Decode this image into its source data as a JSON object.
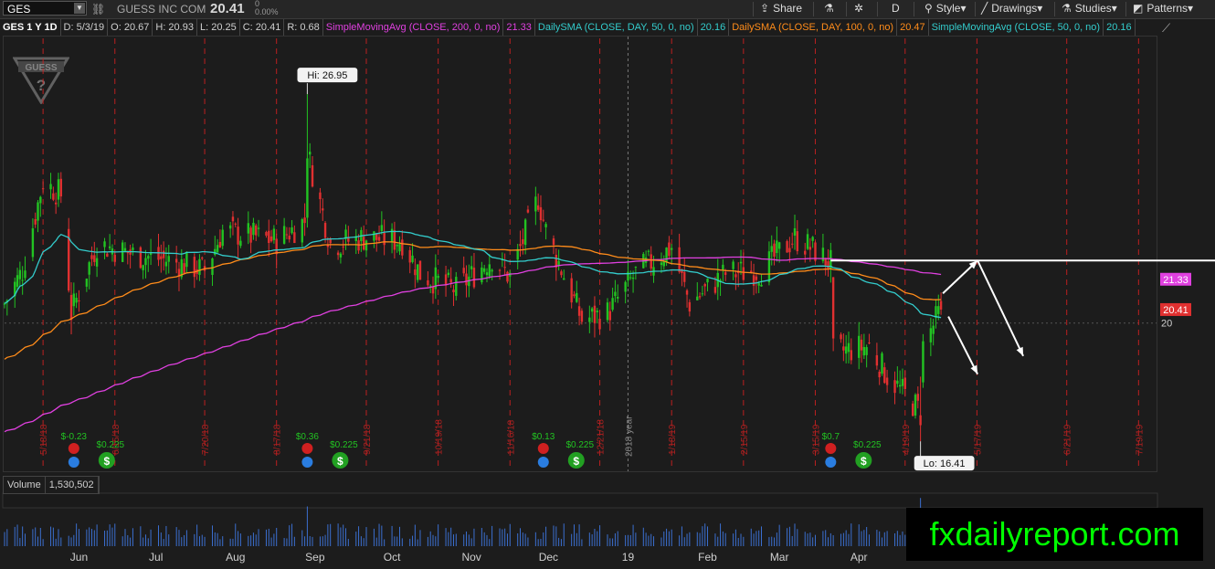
{
  "toolbar": {
    "symbol": "GES",
    "company": "GUESS INC COM",
    "last_price": "20.41",
    "change": "0",
    "change_pct": "0.00%",
    "share_label": "Share",
    "period_label": "D",
    "style_label": "Style",
    "drawings_label": "Drawings",
    "studies_label": "Studies",
    "patterns_label": "Patterns"
  },
  "studies": [
    {
      "text": "GES 1 Y 1D",
      "color": "#ffffff"
    },
    {
      "text": "D: 5/3/19",
      "color": "#cfcfcf"
    },
    {
      "text": "O: 20.67",
      "color": "#cfcfcf"
    },
    {
      "text": "H: 20.93",
      "color": "#cfcfcf"
    },
    {
      "text": "L: 20.25",
      "color": "#cfcfcf"
    },
    {
      "text": "C: 20.41",
      "color": "#cfcfcf"
    },
    {
      "text": "R: 0.68",
      "color": "#cfcfcf"
    },
    {
      "text": "SimpleMovingAvg (CLOSE, 200, 0, no)",
      "color": "#e040e0"
    },
    {
      "text": "21.33",
      "color": "#e040e0"
    },
    {
      "text": "DailySMA (CLOSE, DAY, 50, 0, no)",
      "color": "#33cccc"
    },
    {
      "text": "20.16",
      "color": "#33cccc"
    },
    {
      "text": "DailySMA (CLOSE, DAY, 100, 0, no)",
      "color": "#ff8c1a"
    },
    {
      "text": "20.47",
      "color": "#ff8c1a"
    },
    {
      "text": "SimpleMovingAvg (CLOSE, 50, 0, no)",
      "color": "#33cccc"
    },
    {
      "text": "20.16",
      "color": "#33cccc"
    }
  ],
  "colors": {
    "up": "#22c322",
    "down": "#e03030",
    "sma200": "#e040e0",
    "sma50": "#33cccc",
    "sma100": "#ff8c1a",
    "price_label": "#e03030",
    "resistance_line": "#ffffff",
    "arrows": "#ffffff",
    "expiration_lines": "#cc2020"
  },
  "chart_data": {
    "type": "candlestick",
    "series_names": [],
    "y_scale": "price",
    "y_range": [
      15.5,
      28.7
    ],
    "current_price": 20.41,
    "price_tick": "20",
    "price_labels": [
      {
        "text": "21.33",
        "color": "#e040e0"
      },
      {
        "text": "20.41",
        "color": "#e03030"
      }
    ],
    "high": {
      "label": "Hi: 26.95",
      "value": 26.95,
      "date": "2018-08-29"
    },
    "low": {
      "label": "Lo: 16.41",
      "value": 16.41,
      "date": "2019-04-25"
    },
    "x_labels": [
      "Jun",
      "Jul",
      "Aug",
      "Sep",
      "Oct",
      "Nov",
      "Dec",
      "19",
      "Feb",
      "Mar",
      "Apr"
    ],
    "year_divider": "2018 year",
    "expiration_dates": [
      "5/18/18",
      "6/15/18",
      "7/20/18",
      "8/17/18",
      "9/21/18",
      "10/19/18",
      "11/16/18",
      "12/21/18",
      "1/18/19",
      "2/15/19",
      "3/15/19",
      "4/19/19",
      "5/17/19",
      "6/21/19",
      "7/19/19"
    ],
    "events": [
      {
        "eps": "$-0.23",
        "dividend": "$0.225"
      },
      {
        "eps": "$0.36",
        "dividend": "$0.225"
      },
      {
        "eps": "$0.13",
        "dividend": "$0.225"
      },
      {
        "eps": "$0.7",
        "dividend": "$0.225"
      }
    ],
    "resistance_level": 21.9,
    "sma_last": {
      "sma200": 21.33,
      "sma50": 20.16,
      "sma100": 20.47
    }
  },
  "volume": {
    "label": "Volume",
    "value": "1,530,502"
  },
  "watermark": "fxdailyreport.com",
  "logo_text": "GUESS"
}
